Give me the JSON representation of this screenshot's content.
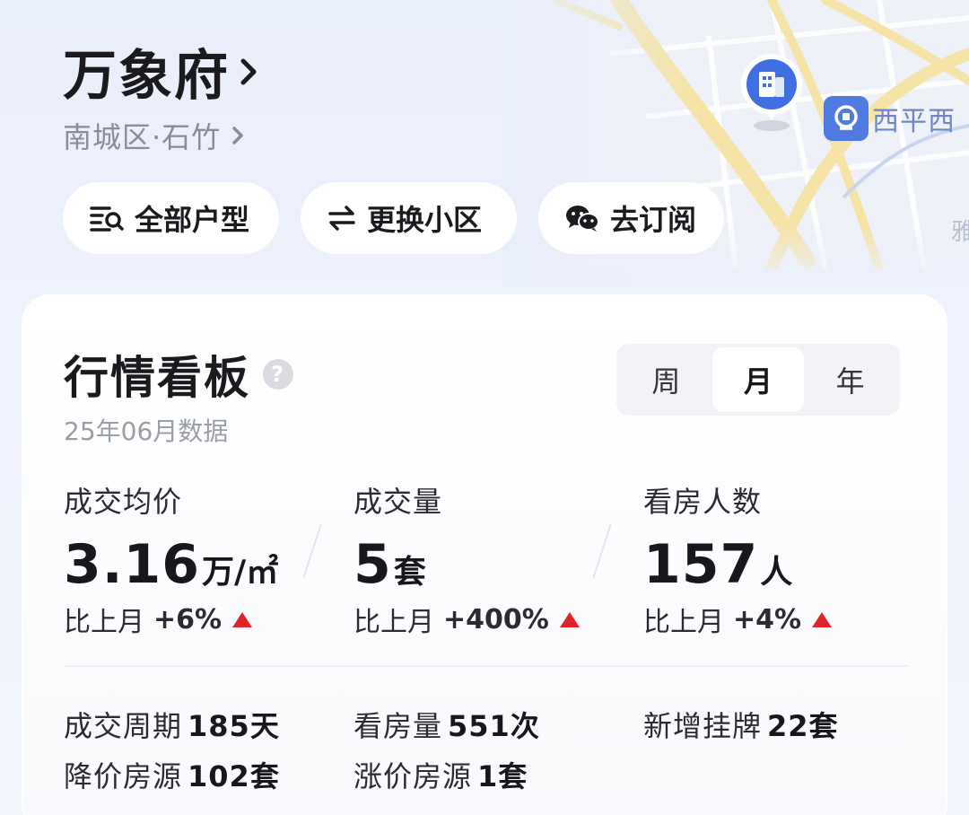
{
  "header": {
    "title": "万象府",
    "location": "南城区·石竹"
  },
  "map": {
    "metro_label": "西平西",
    "edge_text": "雅"
  },
  "pills": [
    {
      "label": "全部户型",
      "icon": "list-search-icon"
    },
    {
      "label": "更换小区",
      "icon": "swap-icon"
    },
    {
      "label": "去订阅",
      "icon": "wechat-icon"
    }
  ],
  "board": {
    "title": "行情看板",
    "help": "?",
    "subtitle": "25年06月数据",
    "periods": [
      "周",
      "月",
      "年"
    ],
    "active_period": "月"
  },
  "stats": [
    {
      "label": "成交均价",
      "value": "3.16",
      "unit": "万/㎡",
      "compare_label": "比上月",
      "change": "+6%"
    },
    {
      "label": "成交量",
      "value": "5",
      "unit": "套",
      "compare_label": "比上月",
      "change": "+400%"
    },
    {
      "label": "看房人数",
      "value": "157",
      "unit": "人",
      "compare_label": "比上月",
      "change": "+4%"
    }
  ],
  "metrics": [
    {
      "label": "成交周期",
      "value": "185天"
    },
    {
      "label": "看房量",
      "value": "551次"
    },
    {
      "label": "新增挂牌",
      "value": "22套"
    },
    {
      "label": "降价房源",
      "value": "102套"
    },
    {
      "label": "涨价房源",
      "value": "1套"
    }
  ],
  "colors": {
    "up_arrow": "#e0232b",
    "map_pin": "#3f6fe0",
    "metro": "#4f7ae0"
  }
}
